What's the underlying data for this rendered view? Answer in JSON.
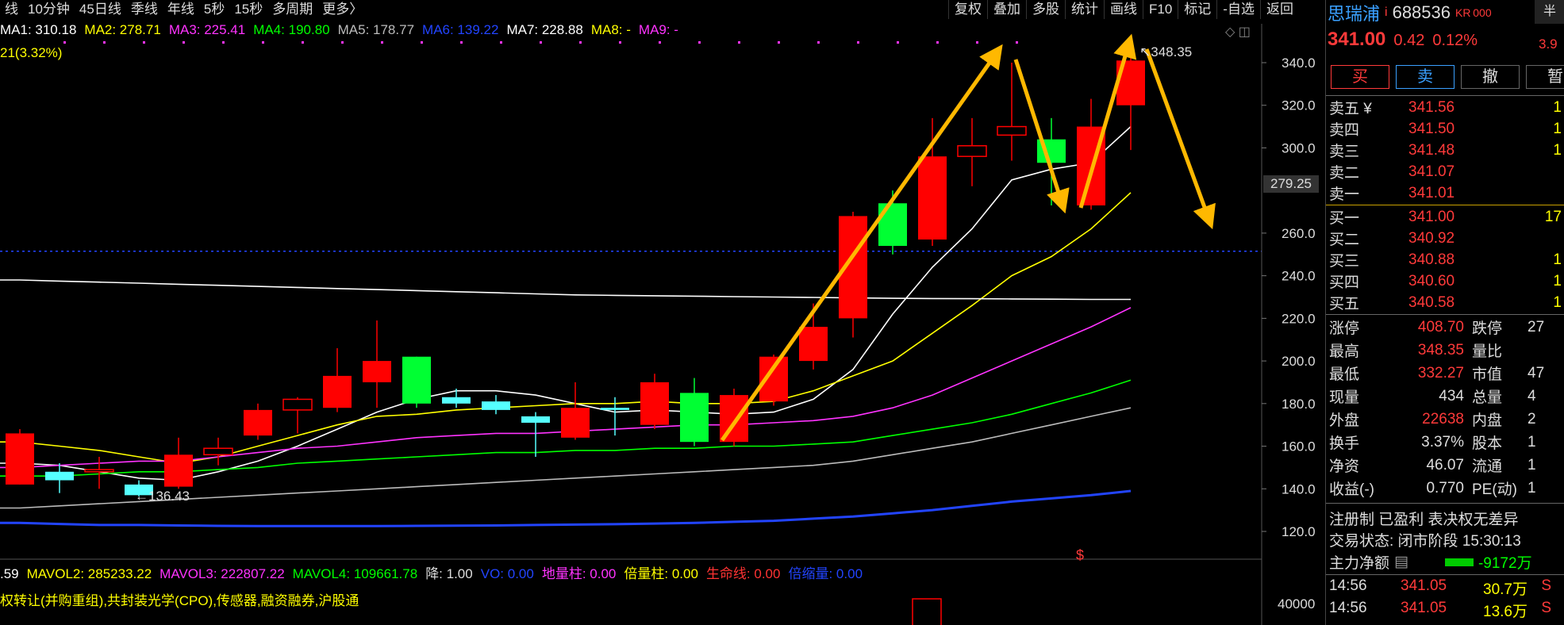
{
  "periods": [
    "线",
    "10分钟",
    "45日线",
    "季线",
    "年线",
    "5秒",
    "15秒",
    "多周期",
    "更多〉"
  ],
  "tools": [
    "复权",
    "叠加",
    "多股",
    "统计",
    "画线",
    "F10",
    "标记",
    "-自选",
    "返回"
  ],
  "ma": [
    {
      "label": "MA1: 310.18",
      "color": "#ffffff"
    },
    {
      "label": "MA2: 278.71",
      "color": "#ffff00"
    },
    {
      "label": "MA3: 225.41",
      "color": "#ff33ff"
    },
    {
      "label": "MA4: 190.80",
      "color": "#00ff00"
    },
    {
      "label": "MA5: 178.77",
      "color": "#bbbbbb"
    },
    {
      "label": "MA6: 139.22",
      "color": "#2244ff"
    },
    {
      "label": "MA7: 228.88",
      "color": "#ffffff"
    },
    {
      "label": "MA8: -",
      "color": "#ffff00"
    },
    {
      "label": "MA9: -",
      "color": "#ff33ff"
    }
  ],
  "change_text": "21(3.32%)",
  "price_axis": [
    {
      "label": "340.0",
      "v": 340
    },
    {
      "label": "320.0",
      "v": 320
    },
    {
      "label": "300.0",
      "v": 300
    },
    {
      "label": "260.0",
      "v": 260
    },
    {
      "label": "240.0",
      "v": 240
    },
    {
      "label": "220.0",
      "v": 220
    },
    {
      "label": "200.0",
      "v": 200
    },
    {
      "label": "180.0",
      "v": 180
    },
    {
      "label": "160.0",
      "v": 160
    },
    {
      "label": "140.0",
      "v": 140
    },
    {
      "label": "120.0",
      "v": 120
    }
  ],
  "cursor_price": "279.25",
  "high_label": "348.35",
  "low_label": "←136.43",
  "vol_axis_label": "40000",
  "vol_stats": [
    {
      "label": ".59",
      "color": "#ffffff"
    },
    {
      "label": "MAVOL2: 285233.22",
      "color": "#ffff00"
    },
    {
      "label": "MAVOL3: 222807.22",
      "color": "#ff33ff"
    },
    {
      "label": "MAVOL4: 109661.78",
      "color": "#00ff00"
    },
    {
      "label": "降: 1.00",
      "color": "#dddddd"
    },
    {
      "label": "VO: 0.00",
      "color": "#2244ff"
    },
    {
      "label": "地量柱: 0.00",
      "color": "#ff33ff"
    },
    {
      "label": "倍量柱: 0.00",
      "color": "#ffff00"
    },
    {
      "label": "生命线: 0.00",
      "color": "#ff3333"
    },
    {
      "label": "倍缩量: 0.00",
      "color": "#2244ff"
    }
  ],
  "concepts": "权转让(并购重组),共封装光学(CPO),传感器,融资融券,沪股通",
  "colors": {
    "up": "#ff0000",
    "down": "#00ff33",
    "down_small": "#55ffff",
    "arrow": "#ffb800",
    "dashline": "#2244ff"
  },
  "candles": [
    {
      "o": 142,
      "c": 166,
      "h": 168,
      "l": 142
    },
    {
      "o": 148,
      "c": 144,
      "h": 152,
      "l": 138
    },
    {
      "o": 148,
      "c": 149,
      "h": 155,
      "l": 140
    },
    {
      "o": 142,
      "c": 137,
      "h": 144,
      "l": 136.43
    },
    {
      "o": 141,
      "c": 156,
      "h": 164,
      "l": 140
    },
    {
      "o": 156,
      "c": 159,
      "h": 164,
      "l": 151
    },
    {
      "o": 165,
      "c": 177,
      "h": 180,
      "l": 163
    },
    {
      "o": 177,
      "c": 182,
      "h": 183,
      "l": 166
    },
    {
      "o": 178,
      "c": 193,
      "h": 206,
      "l": 176
    },
    {
      "o": 190,
      "c": 200,
      "h": 219,
      "l": 178
    },
    {
      "o": 202,
      "c": 180,
      "h": 202,
      "l": 178
    },
    {
      "o": 183,
      "c": 180,
      "h": 187,
      "l": 178
    },
    {
      "o": 181,
      "c": 177,
      "h": 184,
      "l": 175
    },
    {
      "o": 174,
      "c": 171,
      "h": 176,
      "l": 155
    },
    {
      "o": 164,
      "c": 178,
      "h": 190,
      "l": 163
    },
    {
      "o": 178,
      "c": 177,
      "h": 183,
      "l": 165
    },
    {
      "o": 170,
      "c": 190,
      "h": 194,
      "l": 168
    },
    {
      "o": 185,
      "c": 162,
      "h": 192,
      "l": 160
    },
    {
      "o": 162,
      "c": 184,
      "h": 187,
      "l": 160
    },
    {
      "o": 181,
      "c": 202,
      "h": 203,
      "l": 179
    },
    {
      "o": 200,
      "c": 216,
      "h": 227,
      "l": 196
    },
    {
      "o": 220,
      "c": 268,
      "h": 270,
      "l": 211
    },
    {
      "o": 274,
      "c": 254,
      "h": 280,
      "l": 250
    },
    {
      "o": 257,
      "c": 296,
      "h": 314,
      "l": 254
    },
    {
      "o": 296,
      "c": 301,
      "h": 314,
      "l": 282
    },
    {
      "o": 306,
      "c": 310,
      "h": 340,
      "l": 294
    },
    {
      "o": 304,
      "c": 293,
      "h": 314,
      "l": 273
    },
    {
      "o": 273,
      "c": 310,
      "h": 323,
      "l": 271
    },
    {
      "o": 320,
      "c": 341,
      "h": 348.35,
      "l": 299
    }
  ],
  "ma_series": [
    {
      "color": "#ffffff",
      "v": [
        152,
        151,
        148,
        145,
        144,
        148,
        153,
        160,
        168,
        176,
        182,
        186,
        186,
        184,
        180,
        176,
        177,
        176,
        175,
        176,
        182,
        196,
        222,
        244,
        262,
        285,
        290,
        293,
        310
      ]
    },
    {
      "color": "#ffff00",
      "v": [
        162,
        160,
        158,
        155,
        152,
        155,
        160,
        165,
        170,
        174,
        175,
        177,
        178,
        179,
        180,
        180,
        181,
        180,
        180,
        181,
        186,
        193,
        200,
        213,
        226,
        240,
        249,
        262,
        279
      ]
    },
    {
      "color": "#ff33ff",
      "v": [
        150,
        151,
        152,
        153,
        153,
        155,
        157,
        159,
        160,
        162,
        164,
        165,
        166,
        166,
        167,
        168,
        169,
        170,
        170,
        171,
        172,
        174,
        178,
        184,
        192,
        200,
        208,
        216,
        225
      ]
    },
    {
      "color": "#00ff00",
      "v": [
        146,
        146,
        147,
        148,
        148,
        149,
        150,
        152,
        153,
        154,
        155,
        156,
        157,
        157,
        158,
        158,
        159,
        159,
        160,
        160,
        161,
        162,
        165,
        168,
        171,
        175,
        180,
        185,
        191
      ]
    },
    {
      "color": "#bbbbbb",
      "v": [
        131,
        132,
        133,
        134,
        135,
        136,
        137,
        138,
        139,
        140,
        141,
        142,
        143,
        144,
        145,
        146,
        147,
        148,
        149,
        150,
        151,
        153,
        156,
        159,
        162,
        166,
        170,
        174,
        178
      ]
    },
    {
      "color": "#2244ff",
      "v": [
        124,
        123.5,
        123,
        123,
        122.8,
        122.6,
        122.5,
        122.5,
        122.5,
        122.5,
        122.6,
        122.7,
        122.8,
        123,
        123.2,
        123.4,
        123.7,
        124,
        124.5,
        125,
        126,
        127,
        128.5,
        130,
        132,
        134,
        135.5,
        137,
        139
      ]
    },
    {
      "color": "#ffffff",
      "v": [
        238,
        237.5,
        237,
        236.5,
        236,
        235.5,
        235,
        234.5,
        234,
        233.5,
        233,
        232.5,
        232,
        231.5,
        231,
        230.8,
        230.6,
        230.4,
        230.2,
        230,
        229.8,
        229.6,
        229.4,
        229.3,
        229.2,
        229.1,
        229,
        228.9,
        228.88
      ]
    }
  ],
  "panel": {
    "name": "思瑞浦",
    "name_mark": "i",
    "code": "688536",
    "badge": "KR 000",
    "half": "半",
    "half_sub": "3.9",
    "price": "341.00",
    "chg": "0.42",
    "pct": "0.12%",
    "buttons": {
      "buy": "买",
      "sell": "卖",
      "cancel": "撤",
      "more": "暂"
    },
    "asks": [
      {
        "lbl": "卖五 ¥",
        "pr": "341.56",
        "vol": "1"
      },
      {
        "lbl": "卖四",
        "pr": "341.50",
        "vol": "1"
      },
      {
        "lbl": "卖三",
        "pr": "341.48",
        "vol": "1"
      },
      {
        "lbl": "卖二",
        "pr": "341.07",
        "vol": ""
      },
      {
        "lbl": "卖一",
        "pr": "341.01",
        "vol": ""
      }
    ],
    "bids": [
      {
        "lbl": "买一",
        "pr": "341.00",
        "vol": "17"
      },
      {
        "lbl": "买二",
        "pr": "340.92",
        "vol": ""
      },
      {
        "lbl": "买三",
        "pr": "340.88",
        "vol": "1"
      },
      {
        "lbl": "买四",
        "pr": "340.60",
        "vol": "1"
      },
      {
        "lbl": "买五",
        "pr": "340.58",
        "vol": "1"
      }
    ],
    "stats": [
      {
        "k": "涨停",
        "v": "408.70",
        "vc": "red",
        "k2": "跌停",
        "v2": "27",
        "v2c": "green"
      },
      {
        "k": "最高",
        "v": "348.35",
        "vc": "red",
        "k2": "量比",
        "v2": "",
        "v2c": "white"
      },
      {
        "k": "最低",
        "v": "332.27",
        "vc": "red",
        "k2": "市值",
        "v2": "47",
        "v2c": "white"
      },
      {
        "k": "现量",
        "v": "434",
        "vc": "white",
        "k2": "总量",
        "v2": "4",
        "v2c": "white"
      },
      {
        "k": "外盘",
        "v": "22638",
        "vc": "red",
        "k2": "内盘",
        "v2": "2",
        "v2c": "green"
      },
      {
        "k": "换手",
        "v": "3.37%",
        "vc": "white",
        "k2": "股本",
        "v2": "1",
        "v2c": "white"
      },
      {
        "k": "净资",
        "v": "46.07",
        "vc": "white",
        "k2": "流通",
        "v2": "1",
        "v2c": "white"
      },
      {
        "k": "收益(-)",
        "v": "0.770",
        "vc": "white",
        "k2": "PE(动)",
        "v2": "1",
        "v2c": "white"
      }
    ],
    "tags": "注册制 已盈利 表决权无差异",
    "trade_status": "交易状态: 闭市阶段 15:30:13",
    "flow_label": "主力净额",
    "flow_value": "-9172万",
    "ticks": [
      {
        "t": "14:56",
        "p": "341.05",
        "v": "30.7万",
        "f": "S"
      },
      {
        "t": "14:56",
        "p": "341.05",
        "v": "13.6万",
        "f": "S"
      }
    ]
  }
}
